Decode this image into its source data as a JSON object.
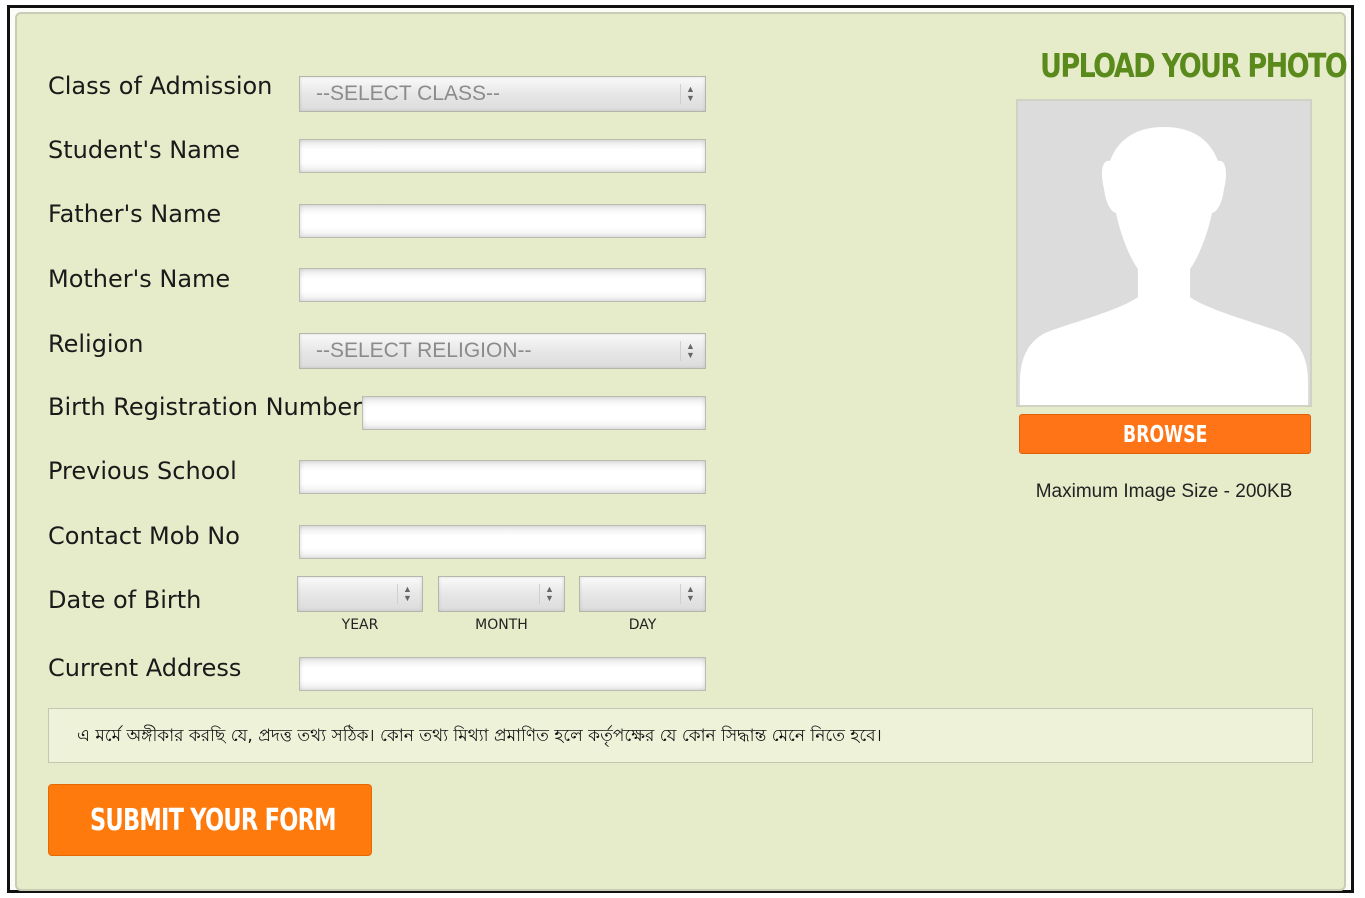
{
  "form": {
    "class_label": "Class of Admission",
    "class_select": "--SELECT CLASS--",
    "student_name_label": "Student's Name",
    "student_name_value": "",
    "father_name_label": "Father's Name",
    "father_name_value": "",
    "mother_name_label": "Mother's Name",
    "mother_name_value": "",
    "religion_label": "Religion",
    "religion_select": "--SELECT RELIGION--",
    "birth_reg_label": "Birth Registration Number",
    "birth_reg_value": "",
    "prev_school_label": "Previous School",
    "prev_school_value": "",
    "contact_label": "Contact Mob No",
    "contact_value": "",
    "dob_label": "Date of Birth",
    "dob_year_select": "",
    "dob_month_select": "",
    "dob_day_select": "",
    "dob_year_label": "YEAR",
    "dob_month_label": "MONTH",
    "dob_day_label": "DAY",
    "address_label": "Current Address",
    "address_value": ""
  },
  "photo": {
    "title": "UPLOAD YOUR PHOTO",
    "browse_label": "BROWSE",
    "max_size": "Maximum Image Size - 200KB",
    "placeholder_icon": "person-silhouette-icon"
  },
  "declaration": "এ মর্মে অঙ্গীকার করছি যে, প্রদত্ত তথ্য সঠিক। কোন তথ্য মিথ্যা প্রমাণিত হলে কর্তৃপক্ষের যে কোন সিদ্ধান্ত মেনে নিতে হবে।",
  "submit_label": "SUBMIT YOUR FORM",
  "colors": {
    "panel_bg": "#e6ecca",
    "accent_orange": "#ff7417",
    "title_green": "#5a8a1c"
  }
}
